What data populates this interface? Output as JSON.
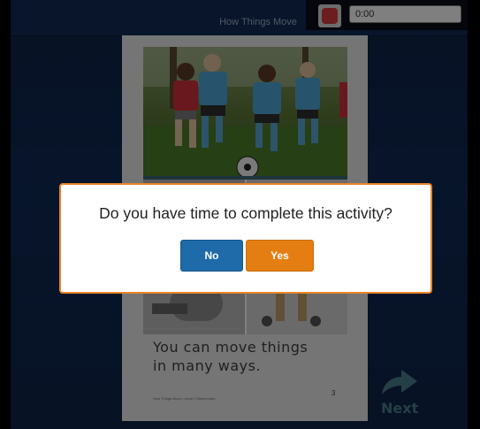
{
  "header": {
    "book_title": "How Things Move",
    "timer_value": "0:00"
  },
  "page": {
    "text_line_1": "You can move things",
    "text_line_2": "in many ways.",
    "footer": "How Things Move • Level C Benchmark",
    "page_number": "3",
    "photos": [
      "children-playing-soccer-photo",
      "children-moving-objects-photo"
    ]
  },
  "navigation": {
    "next_label": "Next"
  },
  "modal": {
    "question": "Do you have time to complete this activity?",
    "no_label": "No",
    "yes_label": "Yes"
  },
  "colors": {
    "background": "#0f2a55",
    "record": "#d83a3a",
    "no_button": "#1f6aa8",
    "yes_button": "#e57e12",
    "modal_border": "#e8852a",
    "next_arrow": "#4b7e8f"
  }
}
